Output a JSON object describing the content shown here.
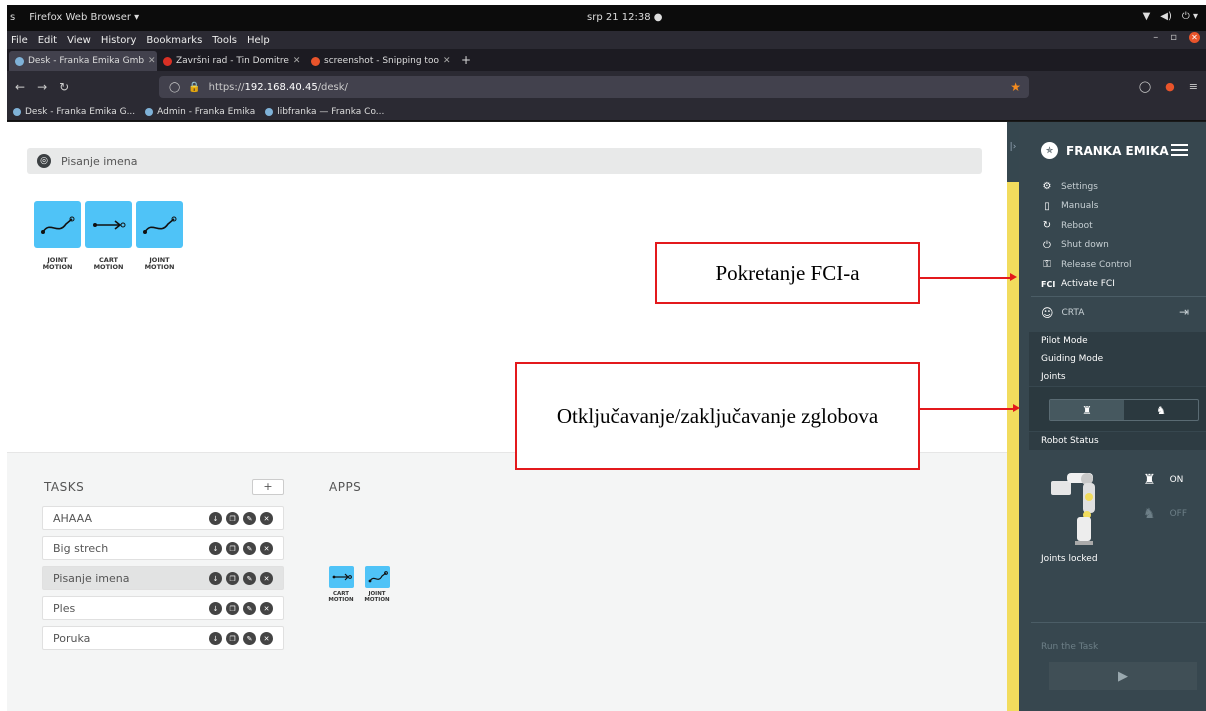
{
  "os": {
    "workspace_label": "s",
    "app_name": "Firefox Web Browser ▾",
    "clock": "srp 21  12:38  ●",
    "tray": [
      "▼",
      "◀)",
      "⏻ ▾"
    ]
  },
  "menubar": [
    "File",
    "Edit",
    "View",
    "History",
    "Bookmarks",
    "Tools",
    "Help"
  ],
  "tabs": [
    {
      "title": "Desk - Franka Emika Gmb",
      "favicon_color": "#7fb2d8",
      "active": true
    },
    {
      "title": "Završni rad - Tin Domitre",
      "favicon_color": "#d93025",
      "active": false
    },
    {
      "title": "screenshot - Snipping too",
      "favicon_color": "#e9542b",
      "active": false
    }
  ],
  "url": {
    "prefix": "https://",
    "host": "192.168.40.45",
    "path": "/desk/"
  },
  "bookmarks": [
    "Desk - Franka Emika G...",
    "Admin - Franka Emika",
    "libfranka — Franka Co..."
  ],
  "workspace": {
    "task_title": "Pisanje imena",
    "timeline": [
      {
        "label": "JOINT\nMOTION",
        "icon": "joint-motion-icon"
      },
      {
        "label": "CART\nMOTION",
        "icon": "cart-motion-icon"
      },
      {
        "label": "JOINT\nMOTION",
        "icon": "joint-motion-icon"
      }
    ]
  },
  "tasks": {
    "heading": "TASKS",
    "add": "+",
    "items": [
      "AHAAA",
      "Big strech",
      "Pisanje imena",
      "Ples",
      "Poruka"
    ],
    "selected": "Pisanje imena"
  },
  "apps": {
    "heading": "APPS",
    "items": [
      {
        "label": "CART\nMOTION",
        "icon": "cart-motion-icon"
      },
      {
        "label": "JOINT\nMOTION",
        "icon": "joint-motion-icon"
      }
    ]
  },
  "sidebar": {
    "brand": "FRANKA EMIKA",
    "menu": [
      {
        "label": "Settings",
        "icon": "gear-icon"
      },
      {
        "label": "Manuals",
        "icon": "manual-icon"
      },
      {
        "label": "Reboot",
        "icon": "reboot-icon"
      },
      {
        "label": "Shut down",
        "icon": "power-icon"
      },
      {
        "label": "Release Control",
        "icon": "key-icon"
      },
      {
        "label": "Activate FCI",
        "icon": "fci-icon",
        "prefix": "FCI"
      }
    ],
    "user": "CRTA",
    "modes": [
      "Pilot Mode",
      "Guiding Mode",
      "Joints"
    ],
    "robot_status_heading": "Robot Status",
    "on_label": "ON",
    "off_label": "OFF",
    "joints_status": "Joints locked",
    "run_heading": "Run the Task"
  },
  "annotations": [
    {
      "text": "Pokretanje FCI-a"
    },
    {
      "text": "Otključavanje/zaključavanje zglobova"
    }
  ],
  "colors": {
    "accent": "#4fc3f7",
    "sidebar": "#37474f",
    "strip": "#f2dc5d",
    "callout": "#e3191c"
  }
}
